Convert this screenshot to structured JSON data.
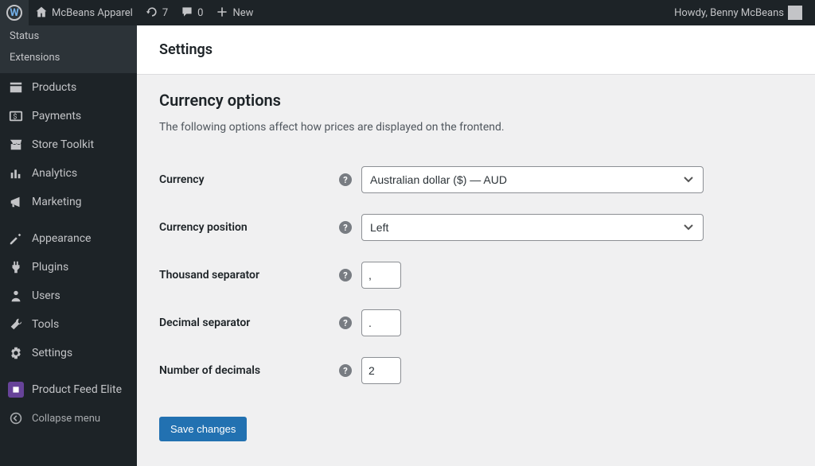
{
  "adminbar": {
    "site_name": "McBeans Apparel",
    "updates_count": "7",
    "comments_count": "0",
    "new_label": "New",
    "howdy": "Howdy, Benny McBeans"
  },
  "sidebar": {
    "submenu": [
      {
        "label": "Status"
      },
      {
        "label": "Extensions"
      }
    ],
    "items": [
      {
        "icon": "products",
        "label": "Products"
      },
      {
        "icon": "payments",
        "label": "Payments"
      },
      {
        "icon": "toolkit",
        "label": "Store Toolkit"
      },
      {
        "icon": "analytics",
        "label": "Analytics"
      },
      {
        "icon": "marketing",
        "label": "Marketing"
      }
    ],
    "items2": [
      {
        "icon": "appearance",
        "label": "Appearance"
      },
      {
        "icon": "plugins",
        "label": "Plugins"
      },
      {
        "icon": "users",
        "label": "Users"
      },
      {
        "icon": "tools",
        "label": "Tools"
      },
      {
        "icon": "settings",
        "label": "Settings"
      }
    ],
    "items3": [
      {
        "icon": "feed",
        "label": "Product Feed Elite"
      }
    ],
    "collapse_label": "Collapse menu"
  },
  "page": {
    "heading": "Settings",
    "section_title": "Currency options",
    "section_desc": "The following options affect how prices are displayed on the frontend.",
    "labels": {
      "currency": "Currency",
      "position": "Currency position",
      "thousand": "Thousand separator",
      "decimal": "Decimal separator",
      "num_decimals": "Number of decimals"
    },
    "values": {
      "currency": "Australian dollar ($) — AUD",
      "position": "Left",
      "thousand": ",",
      "decimal": ".",
      "num_decimals": "2"
    },
    "save_label": "Save changes",
    "help_char": "?"
  }
}
